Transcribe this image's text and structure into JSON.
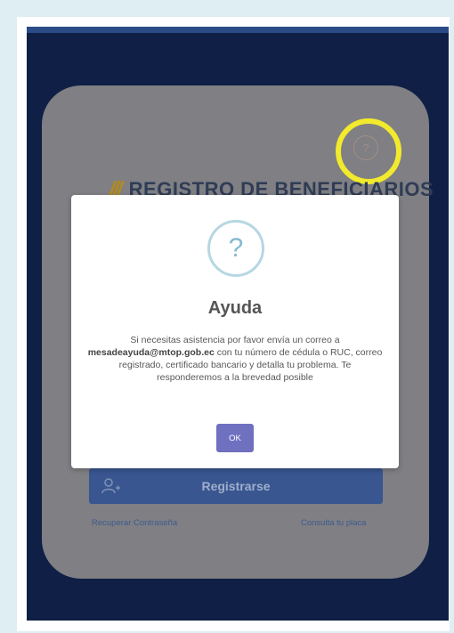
{
  "app": {
    "brand_title": "REGISTRO DE BENEFICIARIOS",
    "brand_mark": "///",
    "register_label": "Registrarse",
    "recover_password_link": "Recuperar Contraseña",
    "plate_lookup_link": "Consulta tu placa",
    "help_icon_glyph": "?"
  },
  "dialog": {
    "icon_glyph": "?",
    "title": "Ayuda",
    "body_prefix": "Si necesitas asistencia por favor envía un correo a ",
    "email": "mesadeayuda@mtop.gob.ec",
    "body_suffix": " con tu número de cédula o RUC, correo registrado, certificado bancario y detalla tu problema. Te responderemos a la brevedad posible",
    "ok_label": "OK"
  },
  "colors": {
    "background": "#0f1f45",
    "card": "#7f7f84",
    "primary_button": "#395690",
    "ok_button": "#7070c0",
    "highlight": "#f2ea2c"
  }
}
